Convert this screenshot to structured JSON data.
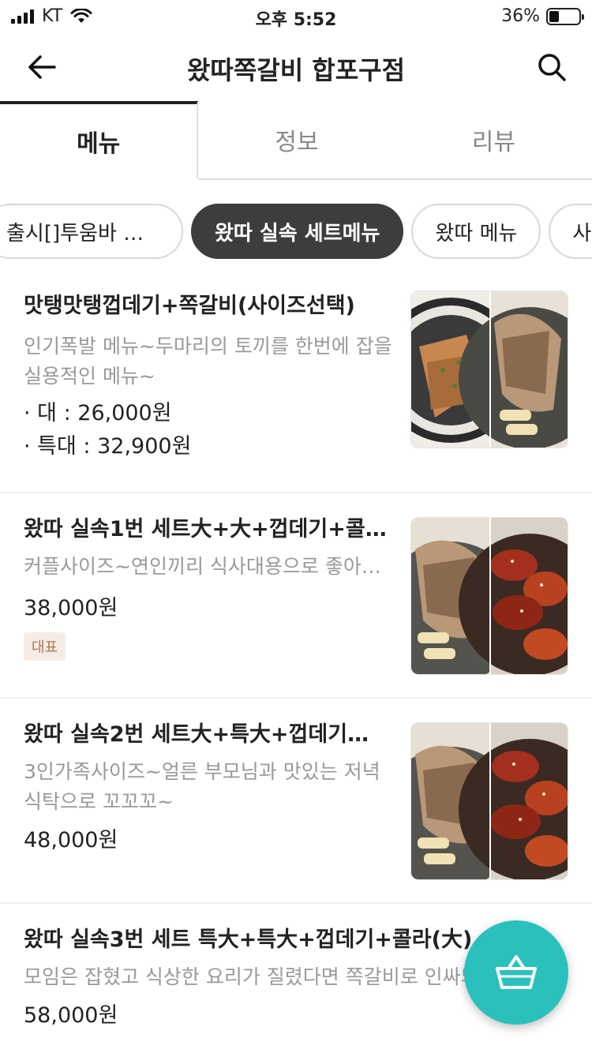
{
  "status_bar": {
    "carrier": "KT",
    "time": "오후 5:52",
    "battery": "36%",
    "battery_level": 0.36
  },
  "header": {
    "title": "왔따쪽갈비 합포구점"
  },
  "tabs": [
    {
      "label": "메뉴",
      "active": true
    },
    {
      "label": "정보",
      "active": false
    },
    {
      "label": "리뷰",
      "active": false
    }
  ],
  "categories": [
    {
      "label": "출시[]투움바 쪽…",
      "active": false
    },
    {
      "label": "왔따 실속 세트메뉴",
      "active": true
    },
    {
      "label": "왔따 메뉴",
      "active": false
    },
    {
      "label": "사이",
      "active": false
    }
  ],
  "menu_items": [
    {
      "name": "맛탱맛탱껍데기+쪽갈비(사이즈선택)",
      "description": "인기폭발 메뉴~두마리의 토끼를 한번에 잡을 실용적인 메뉴~",
      "prices": [
        "· 대 : 26,000원",
        "· 특대 : 32,900원"
      ]
    },
    {
      "name": "왔따 실속1번 세트大+大+껍데기+콜…",
      "description": "커플사이즈~연인끼리 식사대용으로 좋아욤~",
      "prices": [
        "38,000원"
      ],
      "badge": "대표"
    },
    {
      "name": "왔따 실속2번 세트大+특大+껍데기…",
      "description": "3인가족사이즈~얼른 부모님과 맛있는 저녁 식탁으로 꼬꼬꼬~",
      "prices": [
        "48,000원"
      ]
    },
    {
      "name": "왔따 실속3번 세트 특大+특大+껍데기+콜라(大)",
      "description": "모임은 잡혔고 식상한 요리가 질렸다면 쪽갈비로 인싸되기",
      "prices": [
        "58,000원"
      ]
    }
  ],
  "colors": {
    "accent": "#2ac1bc",
    "active_chip": "#3d3d3d",
    "badge_bg": "#f6ece6",
    "badge_text": "#b0734a"
  },
  "icons": {
    "back": "arrow-left-icon",
    "search": "search-icon",
    "cart": "basket-icon"
  }
}
